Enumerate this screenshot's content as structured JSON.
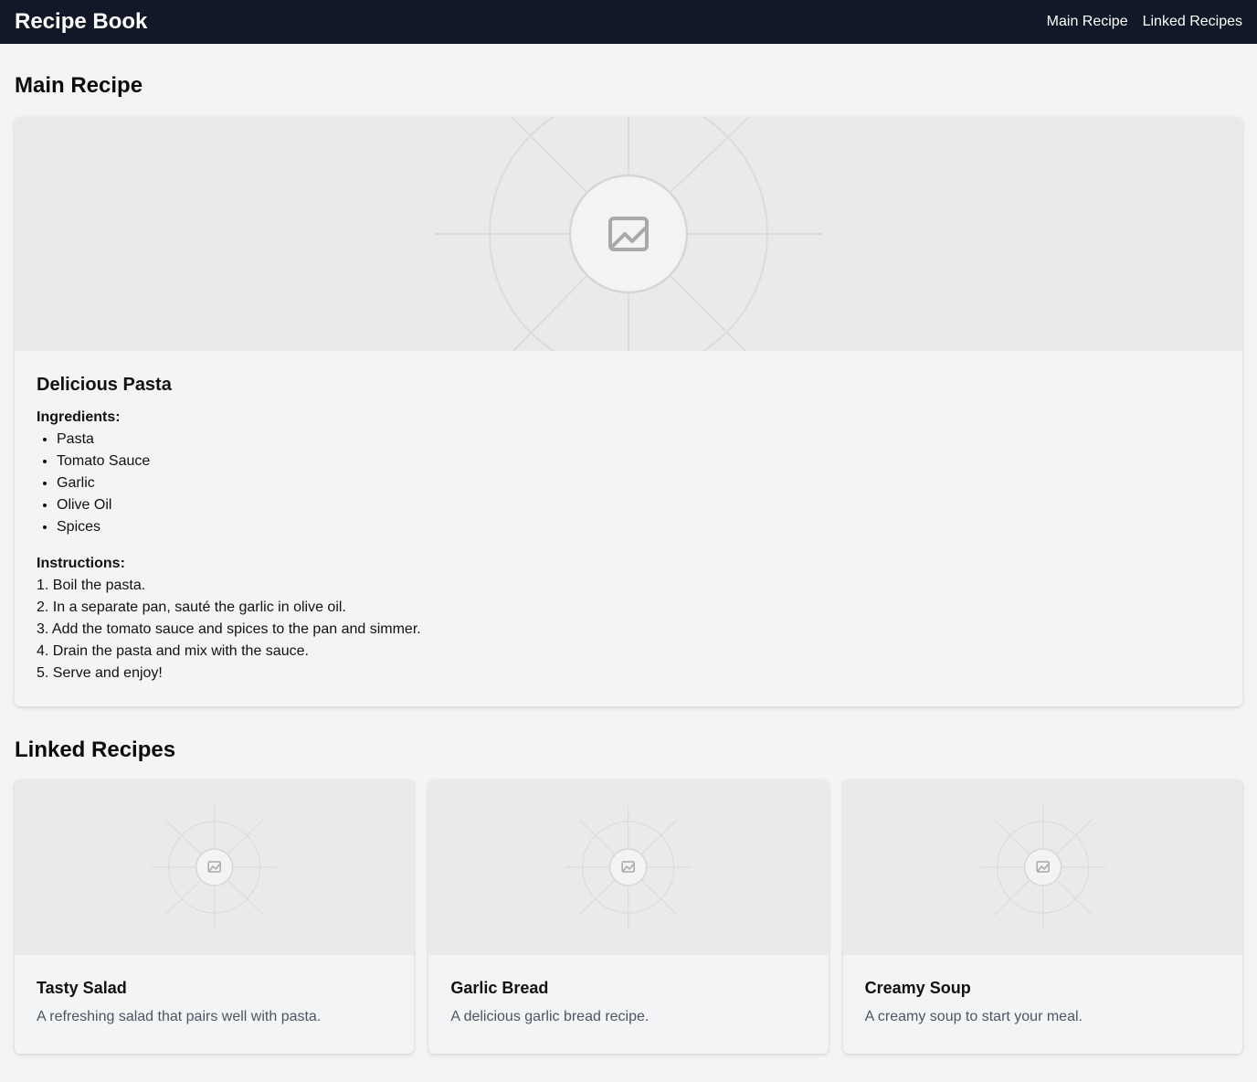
{
  "app": {
    "title": "Recipe Book"
  },
  "nav": {
    "items": [
      {
        "label": "Main Recipe"
      },
      {
        "label": "Linked Recipes"
      }
    ]
  },
  "main": {
    "section_title": "Main Recipe",
    "recipe": {
      "name": "Delicious Pasta",
      "image_icon": "image-icon",
      "ingredients_label": "Ingredients:",
      "ingredients": [
        "Pasta",
        "Tomato Sauce",
        "Garlic",
        "Olive Oil",
        "Spices"
      ],
      "instructions_label": "Instructions:",
      "instructions": [
        "1. Boil the pasta.",
        "2. In a separate pan, sauté the garlic in olive oil.",
        "3. Add the tomato sauce and spices to the pan and simmer.",
        "4. Drain the pasta and mix with the sauce.",
        "5. Serve and enjoy!"
      ]
    }
  },
  "linked": {
    "section_title": "Linked Recipes",
    "recipes": [
      {
        "name": "Tasty Salad",
        "description": "A refreshing salad that pairs well with pasta.",
        "image_icon": "image-icon"
      },
      {
        "name": "Garlic Bread",
        "description": "A delicious garlic bread recipe.",
        "image_icon": "image-icon"
      },
      {
        "name": "Creamy Soup",
        "description": "A creamy soup to start your meal.",
        "image_icon": "image-icon"
      }
    ]
  },
  "colors": {
    "navbar_bg": "#111827",
    "page_bg": "#f3f4f6",
    "placeholder_bg": "#eaeaea",
    "muted_text": "#4b5563"
  }
}
